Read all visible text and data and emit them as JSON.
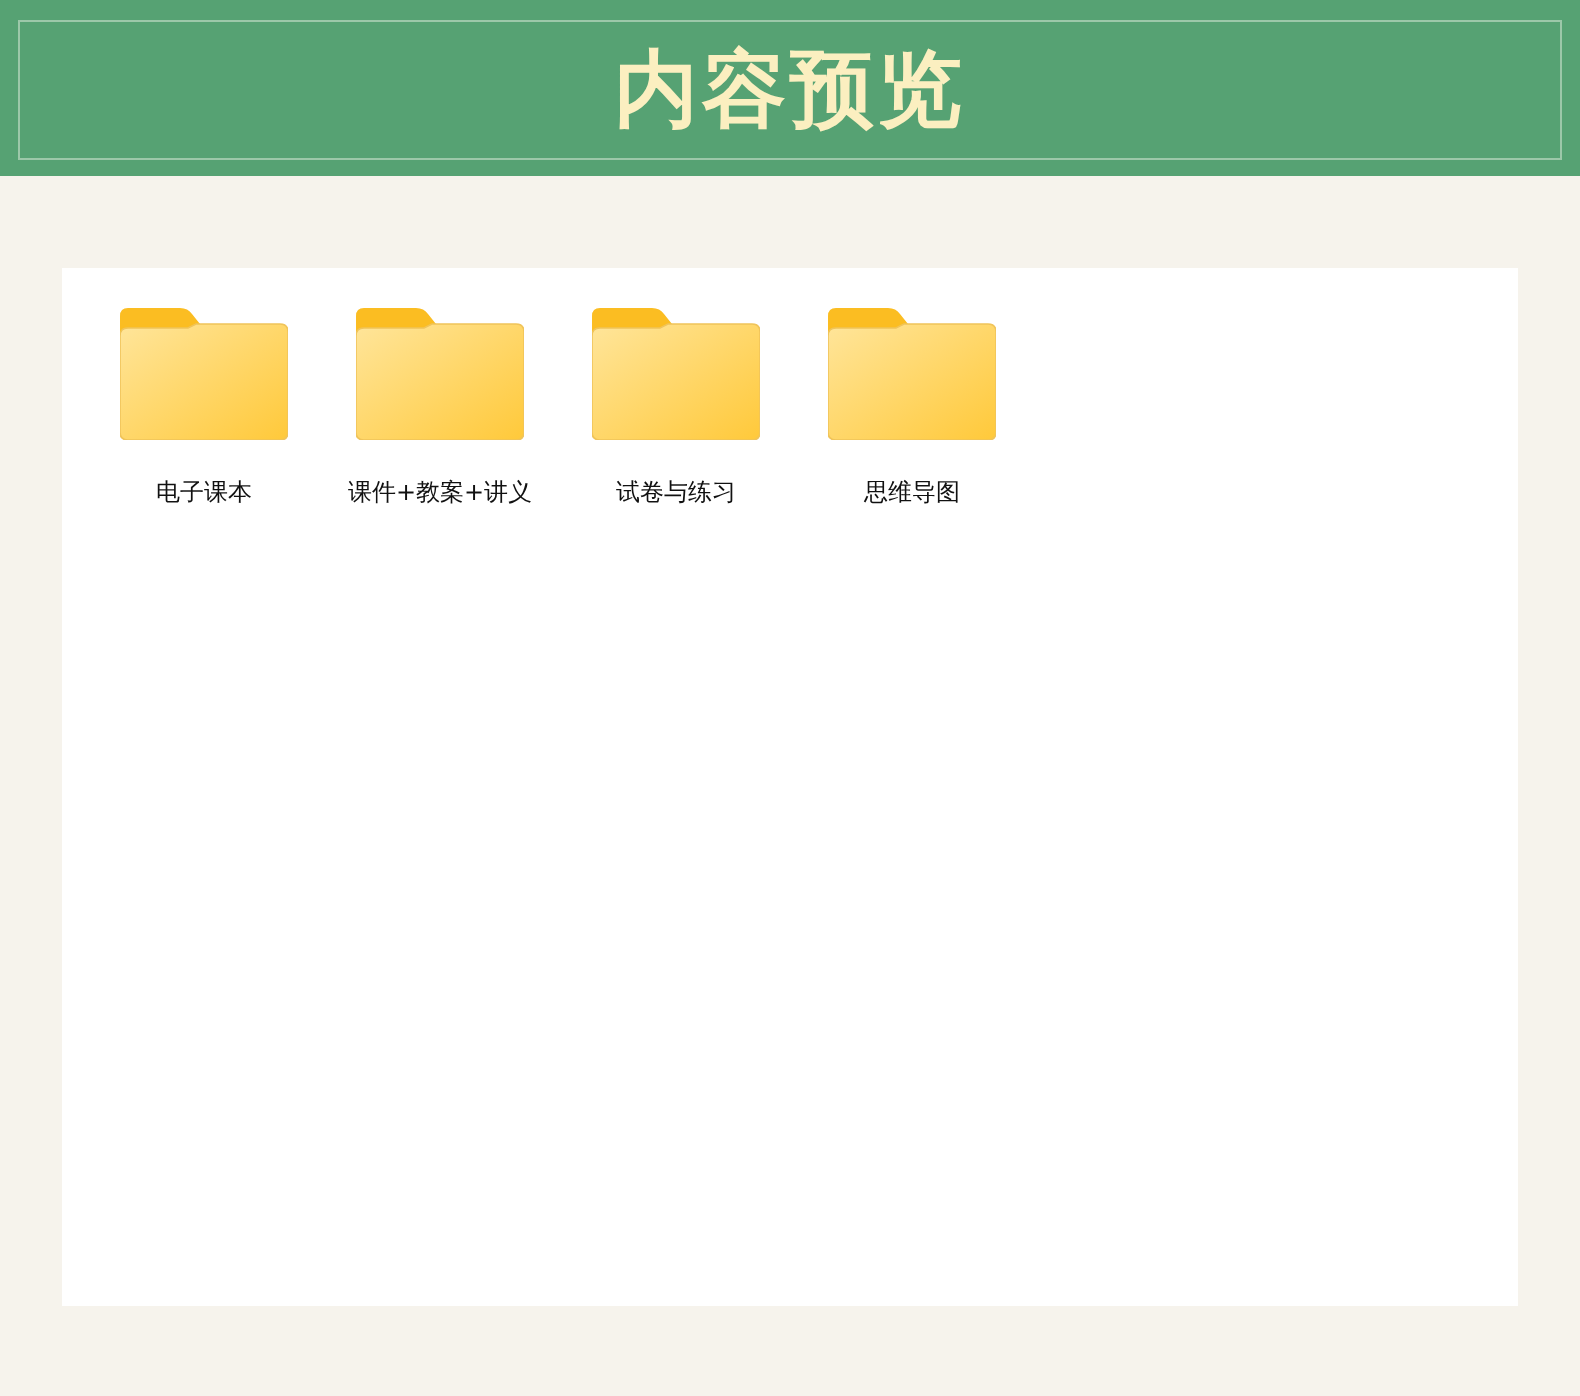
{
  "header": {
    "title": "内容预览"
  },
  "folders": [
    {
      "name": "电子课本"
    },
    {
      "name": "课件+教案+讲义"
    },
    {
      "name": "试卷与练习"
    },
    {
      "name": "思维导图"
    }
  ]
}
